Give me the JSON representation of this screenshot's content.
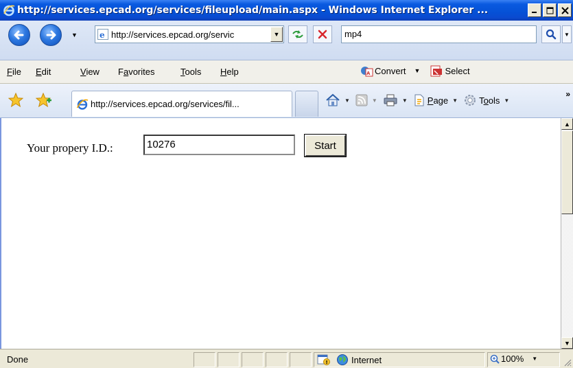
{
  "window": {
    "title": "http://services.epcad.org/services/fileupload/main.aspx - Windows Internet Explorer ...",
    "minimize_label": "_",
    "maximize_label": "□",
    "close_label": "✕"
  },
  "address_bar": {
    "url": "http://services.epcad.org/servic",
    "search_value": "mp4"
  },
  "menu": {
    "items": [
      {
        "key": "F",
        "rest": "ile"
      },
      {
        "key": "E",
        "rest": "dit"
      },
      {
        "key": "V",
        "rest": "iew"
      },
      {
        "key": "a",
        "pre": "F",
        "rest": "vorites"
      },
      {
        "key": "T",
        "rest": "ools"
      },
      {
        "key": "H",
        "rest": "elp"
      }
    ],
    "convert_label": "Convert",
    "select_label": "Select"
  },
  "tab": {
    "title": "http://services.epcad.org/services/fil..."
  },
  "command_bar": {
    "page_label_key": "P",
    "page_label_rest": "age",
    "tools_label_pre": "T",
    "tools_label_key": "o",
    "tools_label_rest": "ols",
    "more_label": "»"
  },
  "content": {
    "property_label": "Your propery I.D.:",
    "property_value": "10276",
    "start_label": "Start"
  },
  "status": {
    "text": "Done",
    "zone": "Internet",
    "zoom": "100%"
  },
  "colors": {
    "titlebar": "#0551d6",
    "window_face": "#ece9d8",
    "accent": "#3a81f3"
  }
}
